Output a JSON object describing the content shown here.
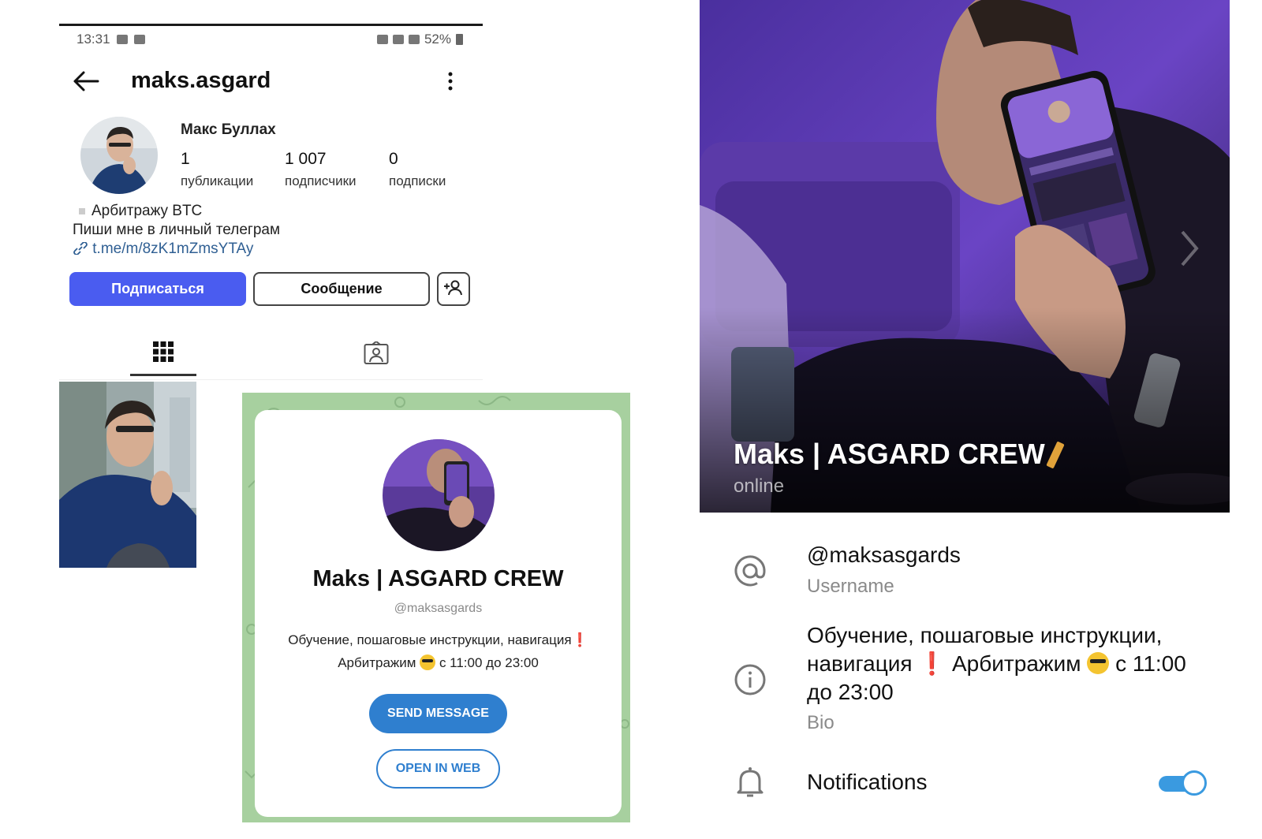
{
  "instagram": {
    "status_bar": {
      "time": "13:31",
      "battery": "52%"
    },
    "header": {
      "username": "maks.asgard"
    },
    "profile": {
      "name": "Макс Буллах",
      "stats": [
        {
          "value": "1",
          "label": "публикации"
        },
        {
          "value": "1 007",
          "label": "подписчики"
        },
        {
          "value": "0",
          "label": "подписки"
        }
      ],
      "bio_line1": "Арбитражу BTC",
      "bio_line2": "Пиши мне в личный телеграм",
      "link": "t.me/m/8zK1mZmsYTAy"
    },
    "buttons": {
      "follow": "Подписаться",
      "message": "Сообщение"
    },
    "accent_color": "#4a5cf0"
  },
  "telegram_card": {
    "title": "Maks | ASGARD CREW",
    "handle": "@maksasgards",
    "bio_part1": "Обучение, пошаговые инструкции, навигация",
    "bio_part2": "Арбитражим",
    "bio_part3": "с 11:00 до 23:00",
    "send_button": "SEND MESSAGE",
    "web_button": "OPEN IN WEB",
    "background_color": "#a7d09f",
    "button_color": "#2f7fcf"
  },
  "telegram_profile": {
    "name": "Maks | ASGARD CREW",
    "status": "online",
    "username": "@maksasgards",
    "username_label": "Username",
    "bio_part1": "Обучение, пошаговые инструкции, навигация",
    "bio_part2": "Арбитражим",
    "bio_part3": "с 11:00 до 23:00",
    "bio_label": "Bio",
    "notifications_label": "Notifications",
    "notifications_on": true,
    "toggle_color": "#3a9ae0"
  }
}
